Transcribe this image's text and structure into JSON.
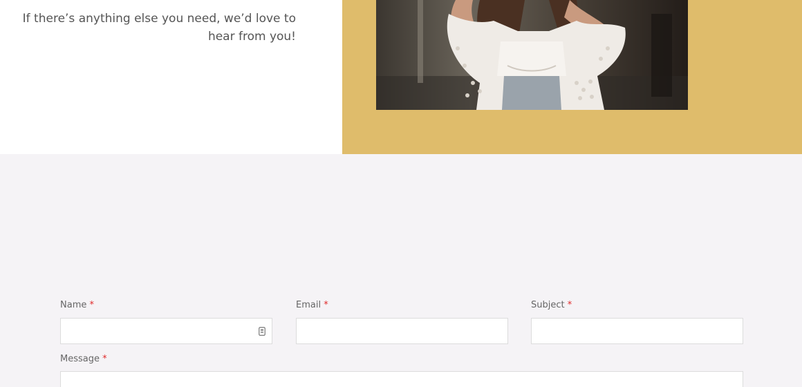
{
  "intro": {
    "line1": "If there’s anything else you need, we’d love to",
    "line2": "hear from you!"
  },
  "colors": {
    "accent_gold": "#dfbc6b",
    "form_background": "#f5f3f6",
    "required_marker": "#e02b2b"
  },
  "hero_image": {
    "subject": "woman in white lace blouse"
  },
  "form": {
    "name": {
      "label": "Name",
      "required_marker": "*",
      "value": "",
      "icon": "autofill-contact-icon"
    },
    "email": {
      "label": "Email",
      "required_marker": "*",
      "value": ""
    },
    "subject": {
      "label": "Subject",
      "required_marker": "*",
      "value": ""
    },
    "message": {
      "label": "Message",
      "required_marker": "*",
      "value": ""
    }
  }
}
